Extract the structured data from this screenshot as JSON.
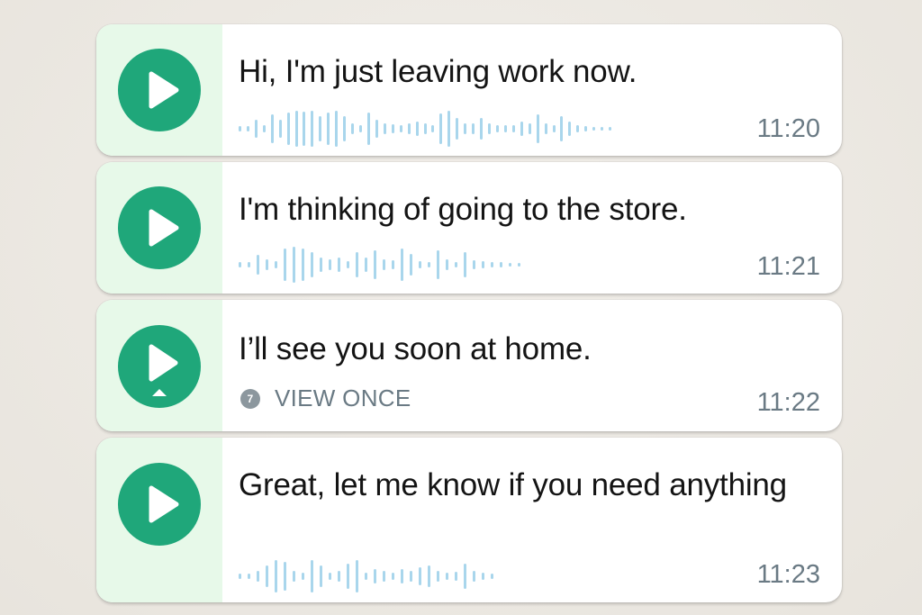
{
  "colors": {
    "accent": "#1fa77a",
    "panel": "#e7f9e9",
    "waveform": "#a9d6ec",
    "timestamp": "#6a7a84"
  },
  "messages": [
    {
      "text": "Hi, I'm just leaving work now.",
      "time": "11:20",
      "icon": "play-icon",
      "waveform": [
        0.15,
        0.15,
        0.5,
        0.2,
        0.8,
        0.5,
        0.9,
        1,
        0.95,
        1,
        0.7,
        0.9,
        1,
        0.7,
        0.3,
        0.2,
        0.9,
        0.5,
        0.3,
        0.25,
        0.2,
        0.3,
        0.4,
        0.3,
        0.2,
        0.85,
        1,
        0.6,
        0.3,
        0.3,
        0.6,
        0.3,
        0.2,
        0.2,
        0.2,
        0.4,
        0.3,
        0.8,
        0.3,
        0.2,
        0.7,
        0.4,
        0.2,
        0.15,
        0.12,
        0.12,
        0.12
      ]
    },
    {
      "text": "I'm thinking of going to the store.",
      "time": "11:21",
      "icon": "play-icon",
      "waveform": [
        0.15,
        0.15,
        0.55,
        0.3,
        0.2,
        0.9,
        1,
        0.9,
        0.7,
        0.4,
        0.3,
        0.4,
        0.2,
        0.7,
        0.4,
        0.8,
        0.3,
        0.25,
        0.9,
        0.6,
        0.2,
        0.15,
        0.8,
        0.3,
        0.15,
        0.7,
        0.25,
        0.2,
        0.15,
        0.13,
        0.12,
        0.12
      ]
    },
    {
      "text": "I’ll see you soon at home.",
      "time": "11:22",
      "icon": "play-once-icon",
      "view_once": {
        "badge": "7",
        "label": "VIEW ONCE"
      }
    },
    {
      "text": "Great, let me know if you need anything",
      "time": "11:23",
      "icon": "play-icon",
      "waveform": [
        0.15,
        0.15,
        0.3,
        0.6,
        0.9,
        0.8,
        0.3,
        0.2,
        0.9,
        0.6,
        0.2,
        0.3,
        0.7,
        0.9,
        0.2,
        0.4,
        0.3,
        0.2,
        0.4,
        0.3,
        0.5,
        0.6,
        0.3,
        0.2,
        0.25,
        0.7,
        0.3,
        0.2,
        0.15
      ]
    }
  ]
}
